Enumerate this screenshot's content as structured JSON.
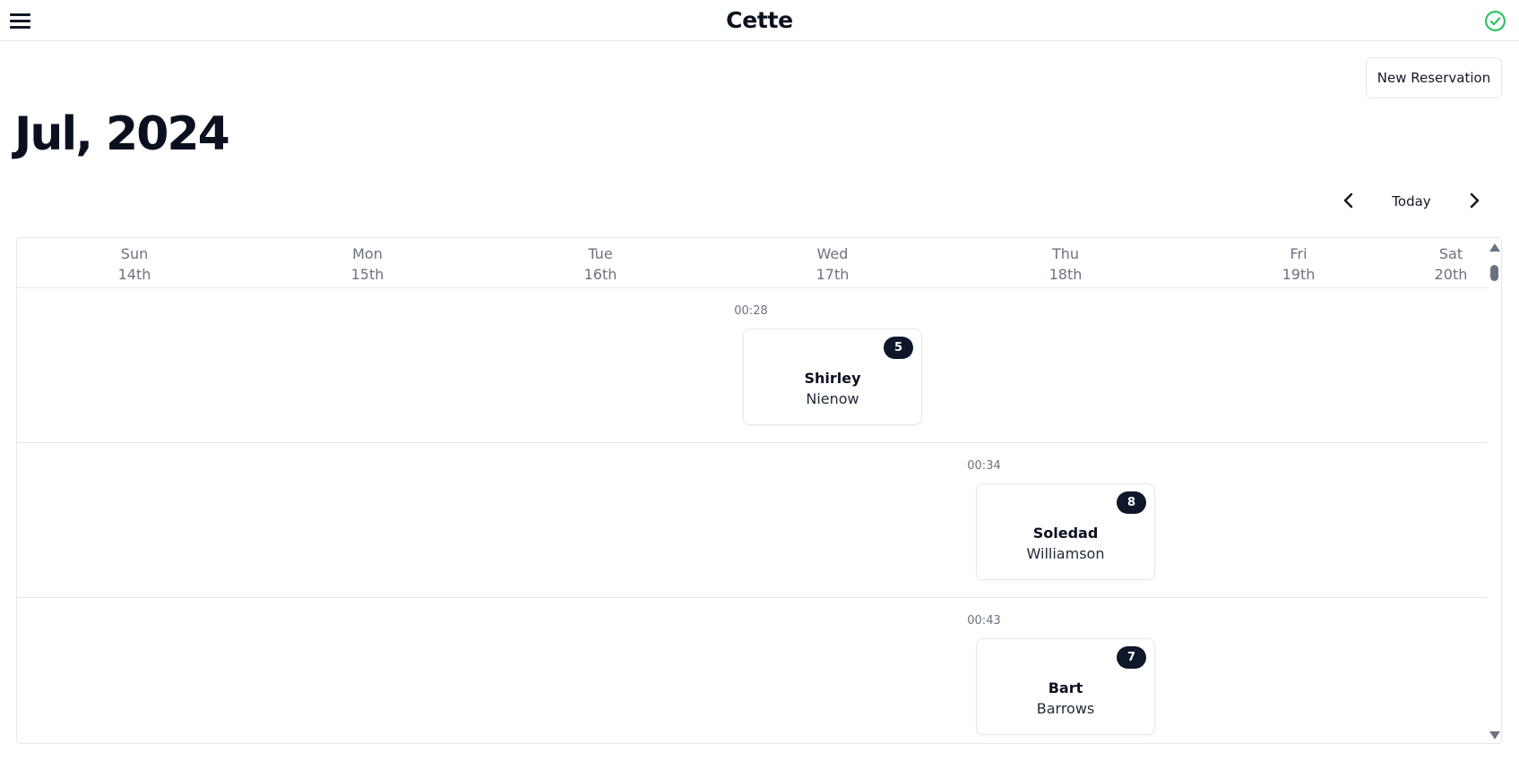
{
  "header": {
    "title": "Cette",
    "menu_icon": "hamburger-menu-icon",
    "status_icon": "check-circle-icon",
    "status_color": "#22c55e"
  },
  "toolbar": {
    "new_reservation_label": "New Reservation",
    "today_label": "Today",
    "prev_icon": "chevron-left-icon",
    "next_icon": "chevron-right-icon"
  },
  "month_title": "Jul, 2024",
  "days": [
    {
      "name": "Sun",
      "date": "14th"
    },
    {
      "name": "Mon",
      "date": "15th"
    },
    {
      "name": "Tue",
      "date": "16th"
    },
    {
      "name": "Wed",
      "date": "17th"
    },
    {
      "name": "Thu",
      "date": "18th"
    },
    {
      "name": "Fri",
      "date": "19th"
    },
    {
      "name": "Sat",
      "date": "20th"
    }
  ],
  "reservations": [
    {
      "time": "00:28",
      "party_size": "5",
      "first_name": "Shirley",
      "last_name": "Nienow",
      "day": "Wed"
    },
    {
      "time": "00:34",
      "party_size": "8",
      "first_name": "Soledad",
      "last_name": "Williamson",
      "day": "Thu"
    },
    {
      "time": "00:43",
      "party_size": "7",
      "first_name": "Bart",
      "last_name": "Barrows",
      "day": "Thu"
    }
  ],
  "colors": {
    "badge_bg": "#0f172a",
    "border": "#e5e7eb",
    "muted_text": "#6b7280"
  }
}
